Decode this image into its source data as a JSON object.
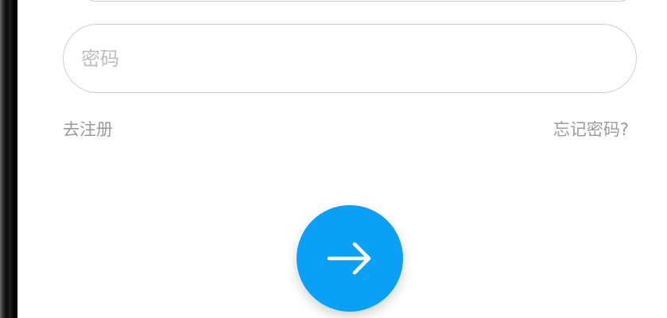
{
  "login_form": {
    "password": {
      "placeholder": "密码",
      "value": ""
    },
    "register_link": "去注册",
    "forgot_password_link": "忘记密码?",
    "submit": {
      "icon": "arrow-right-icon",
      "color": "#0aa0f5"
    }
  }
}
